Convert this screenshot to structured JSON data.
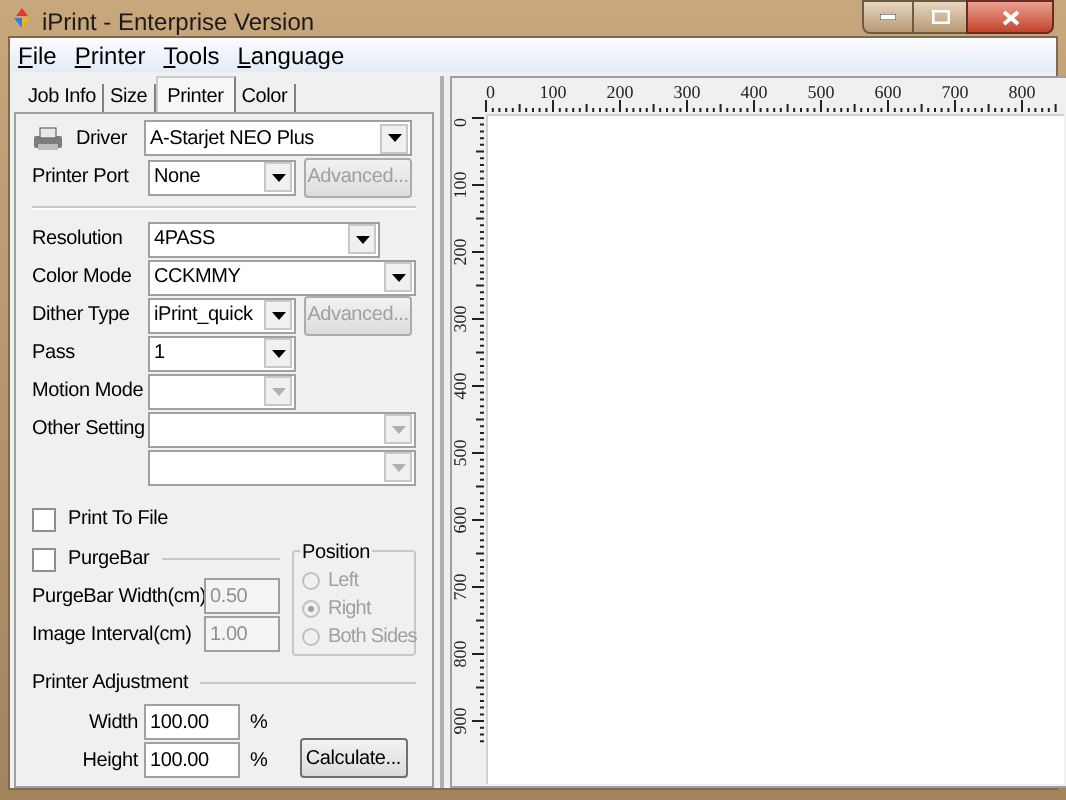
{
  "window": {
    "title": "iPrint - Enterprise Version"
  },
  "menu": [
    "File",
    "Printer",
    "Tools",
    "Language"
  ],
  "tabs": [
    {
      "label": "Job Info",
      "selected": false
    },
    {
      "label": "Size",
      "selected": false
    },
    {
      "label": "Printer",
      "selected": true
    },
    {
      "label": "Color",
      "selected": false
    }
  ],
  "printer_settings": [
    {
      "label": "Driver",
      "value": "A-Starjet NEO Plus",
      "disabled": false
    },
    {
      "label": "Printer Port",
      "value": "None",
      "disabled": false,
      "button": {
        "label": "Advanced...",
        "disabled": true
      }
    }
  ],
  "print_settings": [
    {
      "label": "Resolution",
      "value": "4PASS",
      "disabled": false
    },
    {
      "label": "Color Mode",
      "value": "CCKMMY",
      "disabled": false
    },
    {
      "label": "Dither Type",
      "value": "iPrint_quick",
      "disabled": false,
      "button": {
        "label": "Advanced...",
        "disabled": true
      }
    },
    {
      "label": "Pass",
      "value": "1",
      "disabled": false
    },
    {
      "label": "Motion Mode",
      "disabled": true
    },
    {
      "label": "Other Setting",
      "disabled": true
    },
    {
      "disabled": true
    }
  ],
  "print_to_file": {
    "label": "Print To File",
    "checked": false
  },
  "purgebar": {
    "label": "PurgeBar",
    "checked": false,
    "fields": [
      {
        "label": "PurgeBar Width(cm)",
        "value": "0.50",
        "disabled": true
      },
      {
        "label": "Image Interval(cm)",
        "value": "1.00",
        "disabled": true
      }
    ],
    "position": {
      "title": "Position",
      "options": [
        {
          "label": "Left",
          "selected": false,
          "disabled": true
        },
        {
          "label": "Right",
          "selected": true,
          "disabled": true
        },
        {
          "label": "Both Sides",
          "selected": false,
          "disabled": true
        }
      ]
    }
  },
  "adjustment": {
    "title": "Printer Adjustment",
    "fields": [
      {
        "label": "Width",
        "value": "100.00",
        "unit": "%"
      },
      {
        "label": "Height",
        "value": "100.00",
        "unit": "%"
      }
    ],
    "button": "Calculate..."
  },
  "rulers": {
    "horizontal": [
      "0",
      "100",
      "200",
      "300",
      "400",
      "500",
      "600",
      "700",
      "800"
    ],
    "vertical": [
      "0",
      "100",
      "200",
      "300",
      "400",
      "500",
      "600",
      "700",
      "800",
      "900"
    ]
  }
}
